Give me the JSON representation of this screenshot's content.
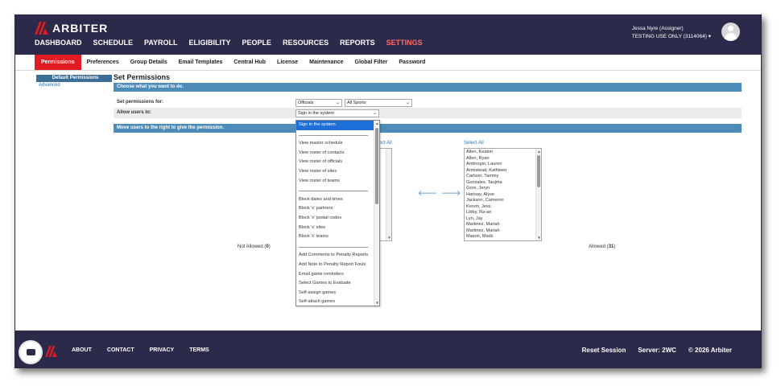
{
  "brand": {
    "name": "ARBITER",
    "accent": "#e01b22",
    "nav_bg": "#2b2a4a"
  },
  "main_nav": [
    "DASHBOARD",
    "SCHEDULE",
    "PAYROLL",
    "ELIGIBILITY",
    "PEOPLE",
    "RESOURCES",
    "REPORTS",
    "SETTINGS"
  ],
  "user": {
    "name": "Jessa Nyre (Assigner)",
    "account": "TESTING USE ONLY (3114064)",
    "caret": "▾"
  },
  "sub_nav": [
    "Permissions",
    "Preferences",
    "Group Details",
    "Email Templates",
    "Central Hub",
    "License",
    "Maintenance",
    "Global Filter",
    "Password"
  ],
  "side_menu": {
    "active": "Default Permissions",
    "link": "Advanced"
  },
  "page": {
    "title": "Set Permissions",
    "choose_bar": "Choose what you want to do.",
    "set_for_label": "Set permissions for:",
    "set_for_value_1": "Officials",
    "set_for_value_2": "All Sports",
    "allow_label": "Allow users to:",
    "allow_value": "Sign in the system",
    "move_bar": "Move users to the right to give the permission.",
    "select_all_left": "elect All",
    "select_all_right": "Select All",
    "not_allowed_label": "Not Allowed (",
    "not_allowed_count": "0",
    "allowed_label": "Allowed (",
    "allowed_count": "31",
    "close_paren": ")"
  },
  "allowed_users": [
    "Allen, Keaton",
    "Allen, Ryan",
    "Ambrogio, Lauren",
    "Armistead, Kathleen",
    "Carlson, Tammy",
    "Gonzales, Taujma",
    "Gore, Jeryn",
    "Harisay, Alyse",
    "Jackson, Cameron",
    "Kervin, Jess",
    "Libby, Ra-an",
    "Lyn, Jay",
    "Martinez, Mariah",
    "Martinez, Mariah",
    "Mason, Mads"
  ],
  "dropdown_options": [
    {
      "label": "Sign in the system",
      "type": "selected"
    },
    {
      "label": "",
      "type": "sep"
    },
    {
      "label": "View master schedule",
      "type": "opt"
    },
    {
      "label": "View roster of contacts",
      "type": "opt"
    },
    {
      "label": "View roster of officials",
      "type": "opt"
    },
    {
      "label": "View roster of sites",
      "type": "opt"
    },
    {
      "label": "View roster of teams",
      "type": "opt"
    },
    {
      "label": "",
      "type": "sep"
    },
    {
      "label": "Block dates and times",
      "type": "opt"
    },
    {
      "label": "Block 'x' partners",
      "type": "opt"
    },
    {
      "label": "Block 'x' postal codes",
      "type": "opt"
    },
    {
      "label": "Block 'x' sites",
      "type": "opt"
    },
    {
      "label": "Block 'x' teams",
      "type": "opt"
    },
    {
      "label": "",
      "type": "sep"
    },
    {
      "label": "Add Comments to Penalty Reports",
      "type": "opt"
    },
    {
      "label": "Add Note to Penalty Report Fouls",
      "type": "opt"
    },
    {
      "label": "Email game reminders",
      "type": "opt"
    },
    {
      "label": "Select Games to Evaluate",
      "type": "opt"
    },
    {
      "label": "Self-assign games",
      "type": "opt"
    },
    {
      "label": "Self-attach games",
      "type": "opt"
    }
  ],
  "footer": {
    "links": [
      "ABOUT",
      "CONTACT",
      "PRIVACY",
      "TERMS"
    ],
    "reset": "Reset Session",
    "server": "Server: 2WC",
    "copyright": "© 2026 Arbiter"
  },
  "icons": {
    "chevron": "chevron-down-icon",
    "up": "▲",
    "down": "▼",
    "left_arrow": "🡐",
    "right_arrow": "🡒"
  }
}
